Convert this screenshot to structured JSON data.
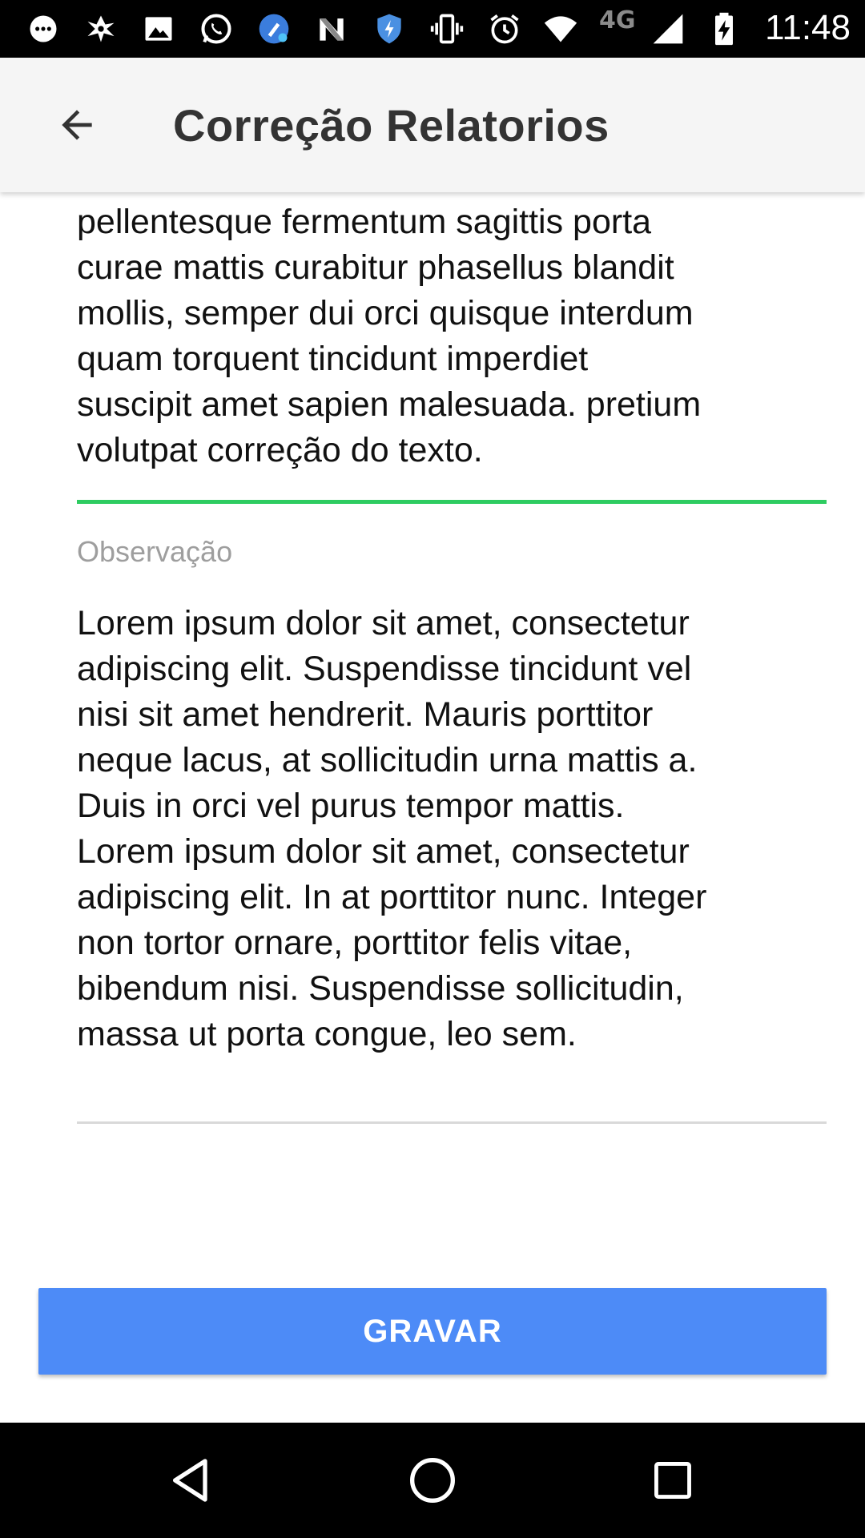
{
  "status_bar": {
    "network": "4G",
    "time": "11:48",
    "icons": [
      "chat-bubble-icon",
      "pinwheel-app-icon",
      "gallery-icon",
      "whatsapp-icon",
      "cleaner-app-icon",
      "n-app-icon",
      "shield-icon",
      "vibrate-icon",
      "alarm-icon",
      "wifi-icon",
      "cell-signal-icon",
      "battery-charging-icon"
    ]
  },
  "app_bar": {
    "back_icon": "arrow-left-icon",
    "title": "Correção Relatorios"
  },
  "form": {
    "first_field_value": "maecenas condimentum tincidunt\npellentesque fermentum sagittis porta\ncurae mattis curabitur phasellus blandit\nmollis, semper dui orci quisque interdum\nquam torquent tincidunt imperdiet\nsuscipit amet sapien malesuada. pretium\nvolutpat correção do texto.",
    "observation_label": "Observação",
    "observation_value": "Lorem ipsum dolor sit amet, consectetur\nadipiscing elit. Suspendisse tincidunt vel\nnisi sit amet hendrerit. Mauris porttitor\nneque lacus, at sollicitudin urna mattis a.\nDuis in orci vel purus tempor mattis.\nLorem ipsum dolor sit amet, consectetur\nadipiscing elit. In at porttitor nunc. Integer\nnon tortor ornare, porttitor felis vitae,\nbibendum nisi. Suspendisse sollicitudin,\nmassa ut porta congue, leo sem."
  },
  "actions": {
    "save_label": "GRAVAR"
  },
  "colors": {
    "active_underline": "#2ecc61",
    "save_button": "#4d8bf7",
    "app_bar": "#f5f5f5"
  },
  "nav_bar": {
    "icons": [
      "back-triangle-icon",
      "home-circle-icon",
      "recents-square-icon"
    ]
  }
}
